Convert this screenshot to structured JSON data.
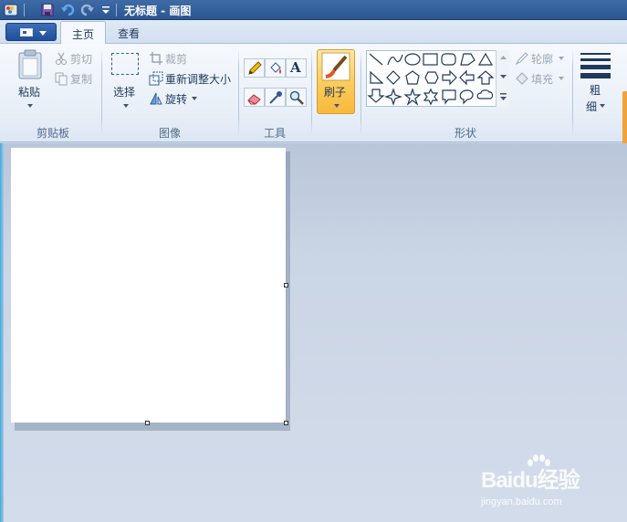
{
  "window": {
    "title": "无标题 - 画图"
  },
  "tabs": [
    {
      "label": "主页",
      "active": true
    },
    {
      "label": "查看",
      "active": false
    }
  ],
  "clipboard": {
    "paste_label": "粘贴",
    "cut_label": "剪切",
    "copy_label": "复制",
    "group_label": "剪贴板"
  },
  "image": {
    "select_label": "选择",
    "crop_label": "裁剪",
    "resize_label": "重新调整大小",
    "rotate_label": "旋转",
    "group_label": "图像"
  },
  "tools": {
    "group_label": "工具",
    "text_glyph": "A"
  },
  "brushes": {
    "label": "刷子"
  },
  "shapes": {
    "outline_label": "轮廓",
    "fill_label": "填充",
    "group_label": "形状"
  },
  "size": {
    "label_line1": "粗",
    "label_line2": "细"
  },
  "watermark": {
    "brand": "Baidu经验",
    "url": "jingyan.baidu.com"
  },
  "colors": {
    "accent": "#2b5690",
    "brush_highlight": "#fbcb5a",
    "workspace": "#c8d3e4"
  }
}
